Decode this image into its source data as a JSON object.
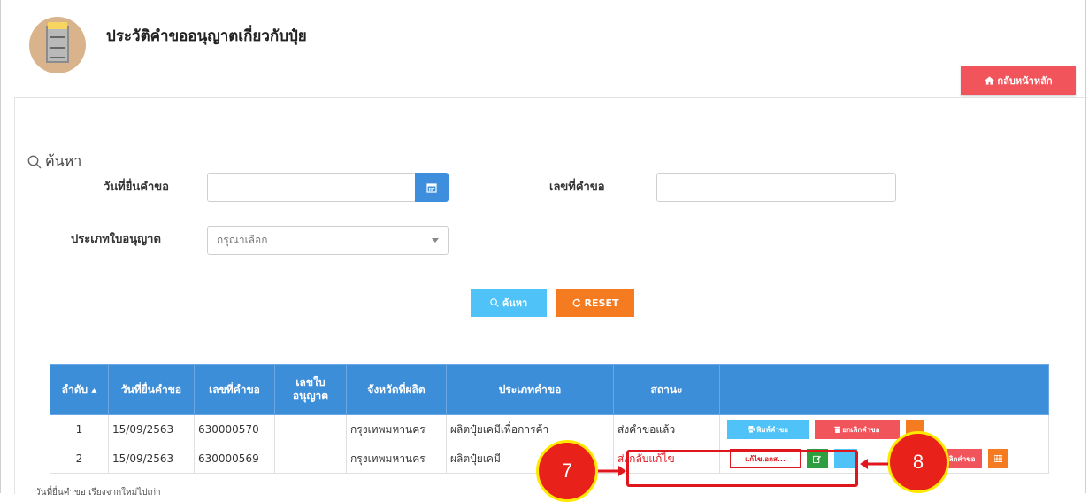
{
  "page": {
    "title": "ประวัติคำขออนุญาตเกี่ยวกับปุ๋ย",
    "home_button": "กลับหน้าหลัก"
  },
  "search": {
    "heading": "ค้นหา",
    "date_label": "วันที่ยื่นคำขอ",
    "request_no_label": "เลขที่คำขอ",
    "license_type_label": "ประเภทใบอนุญาต",
    "license_type_placeholder": "กรุณาเลือก",
    "search_button": "ค้นหา",
    "reset_button": "RESET"
  },
  "table": {
    "headers": [
      "ลำดับ",
      "วันที่ยื่นคำขอ",
      "เลขที่คำขอ",
      "เลขใบ อนุญาต",
      "จังหวัดที่ผลิต",
      "ประเภทคำขอ",
      "สถานะ",
      ""
    ],
    "rows": [
      {
        "no": "1",
        "date": "15/09/2563",
        "request_no": "630000570",
        "license_no": "",
        "province": "กรุงเทพมหานคร",
        "type": "ผลิตปุ๋ยเคมีเพื่อการค้า",
        "status": "ส่งคำขอแล้ว",
        "actions": {
          "print": "พิมพ์คำขอ",
          "cancel": "ยกเลิกคำขอ"
        }
      },
      {
        "no": "2",
        "date": "15/09/2563",
        "request_no": "630000569",
        "license_no": "",
        "province": "กรุงเทพมหานคร",
        "type": "ผลิตปุ๋ยเคมี",
        "status": "ส่งกลับแก้ไข",
        "actions": {
          "edit_doc": "แก้ไขเอกส...",
          "cancel": "กเลิกคำขอ"
        }
      }
    ]
  },
  "callouts": {
    "left": "7",
    "right": "8"
  },
  "footer": {
    "note": "วันที่ยื่นคำขอ เรียงจากใหม่ไปเก่า"
  },
  "icons": {
    "home": "home-icon",
    "calendar": "calendar-icon",
    "search": "search-icon",
    "reset": "refresh-icon",
    "print": "print-icon",
    "trash": "trash-icon",
    "edit": "edit-icon",
    "table": "table-icon",
    "dropdown": "caret-down-icon"
  },
  "colors": {
    "header_blue": "#3d8ed9",
    "danger": "#f2545b",
    "orange": "#f47b20",
    "info": "#4fc3f7",
    "success": "#2e9e3e",
    "callout_red": "#e8211b",
    "callout_border": "#ffe900"
  }
}
